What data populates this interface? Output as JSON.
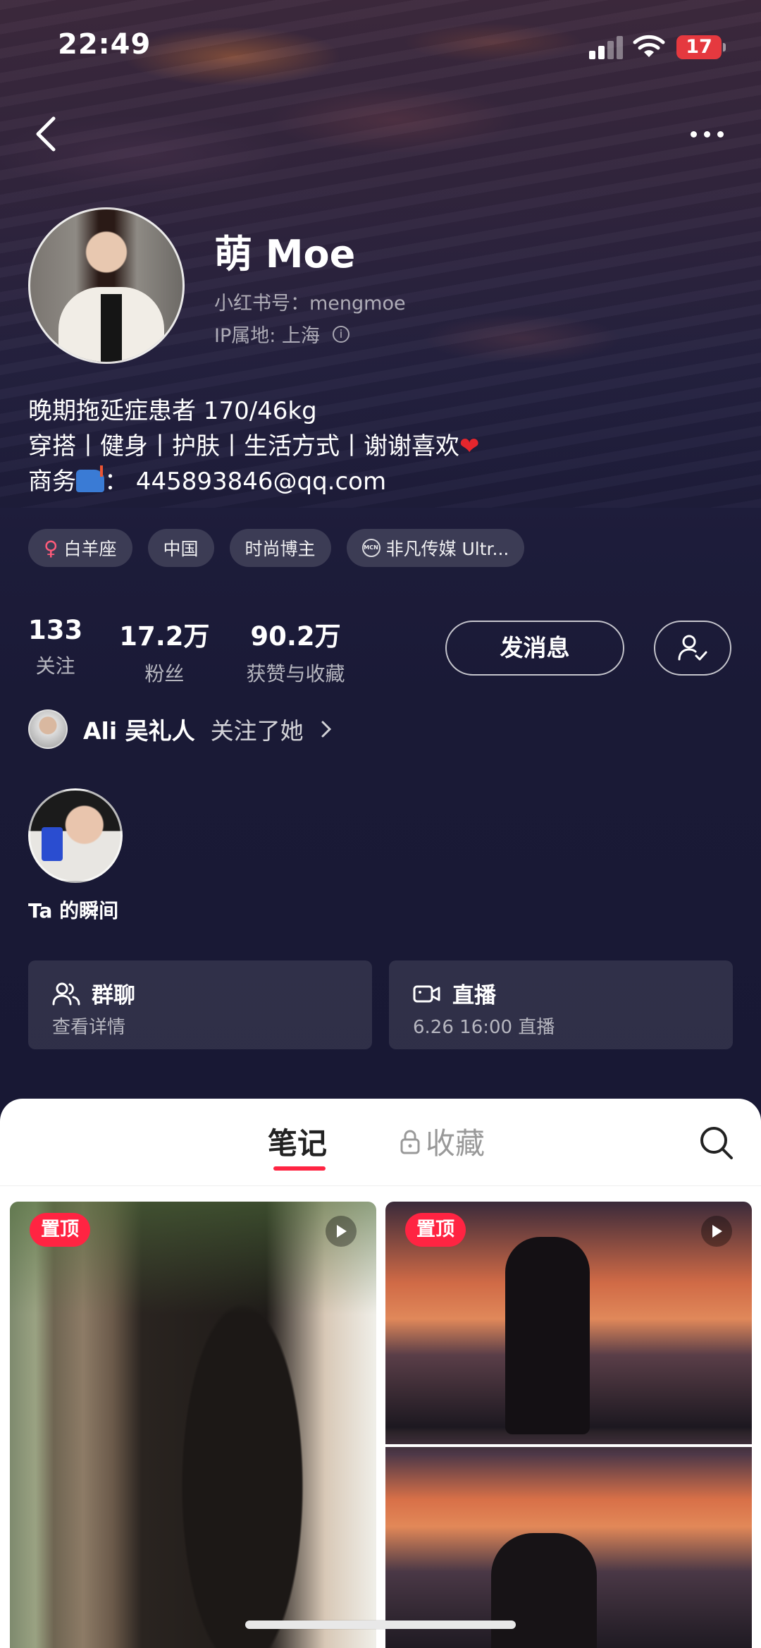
{
  "status_bar": {
    "time": "22:49",
    "battery": "17"
  },
  "profile": {
    "name": "萌 Moe",
    "red_id": "小红书号：mengmoe",
    "ip_location": "IP属地: 上海",
    "bio": {
      "line1": "晚期拖延症患者 170/46kg",
      "line2": "穿搭丨健身丨护肤丨生活方式丨谢谢喜欢",
      "line3_prefix": "商务",
      "line3_suffix": "： 445893846@qq.com"
    },
    "tags": [
      "白羊座",
      "中国",
      "时尚博主",
      "非凡传媒 Ultr..."
    ],
    "stats": [
      {
        "value": "133",
        "label": "关注"
      },
      {
        "value": "17.2万",
        "label": "粉丝"
      },
      {
        "value": "90.2万",
        "label": "获赞与收藏"
      }
    ],
    "message_button": "发消息"
  },
  "followed_by": {
    "name": "Ali 吴礼人",
    "action": "关注了她"
  },
  "moments": {
    "label": "Ta 的瞬间"
  },
  "cards": {
    "group_chat": {
      "title": "群聊",
      "subtitle": "查看详情"
    },
    "live": {
      "title": "直播",
      "subtitle": "6.26 16:00 直播"
    }
  },
  "tabs": {
    "notes": "笔记",
    "favorites": "收藏"
  },
  "posts": [
    {
      "badge": "置顶"
    },
    {
      "badge": "置顶"
    }
  ],
  "colors": {
    "accent": "#ff2442",
    "heart": "#e5262d",
    "battery": "#e5393f"
  }
}
